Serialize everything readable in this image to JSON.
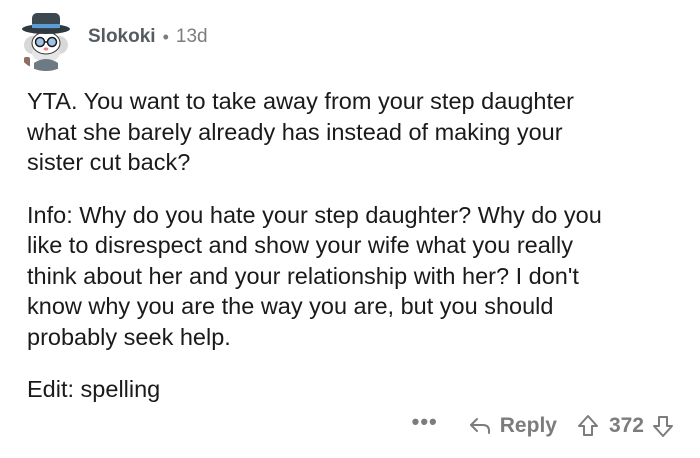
{
  "comment": {
    "username": "Slokoki",
    "separator": "•",
    "age": "13d",
    "paragraphs": [
      "YTA. You want to take away from your step daughter\nwhat she barely already has instead of making your\nsister cut back?",
      "Info: Why do you hate your step daughter? Why do you\nlike to disrespect and show your wife what you really\nthink about her and your relationship with her? I don't\nknow why you are the way you are, but you should\nprobably seek help.",
      "Edit: spelling"
    ],
    "actions": {
      "more_label": "•••",
      "reply_label": "Reply",
      "score": "372"
    }
  },
  "icons": {
    "avatar": "snoo-avatar-icon",
    "reply": "reply-arrow-icon",
    "upvote": "upvote-arrow-icon",
    "downvote": "downvote-arrow-icon"
  },
  "colors": {
    "text": "#1a1a1b",
    "muted": "#7c7c7c",
    "username": "#555c61"
  }
}
